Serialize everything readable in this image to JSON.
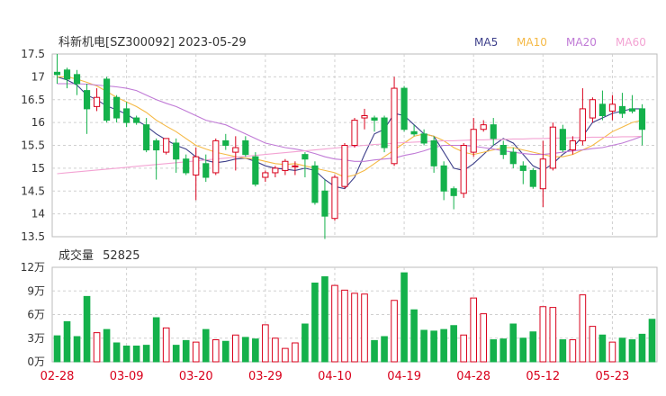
{
  "header": {
    "title": "科新机电[SZ300092] 2023-05-29"
  },
  "volume_header": {
    "label": "成交量",
    "value": "52825"
  },
  "legend": [
    {
      "name": "MA5",
      "color": "#3d3f8a"
    },
    {
      "name": "MA10",
      "color": "#f5b945"
    },
    {
      "name": "MA20",
      "color": "#c07ad6"
    },
    {
      "name": "MA60",
      "color": "#f3a3d3"
    }
  ],
  "colors": {
    "up": "#d9001b",
    "down": "#14b14b"
  },
  "chart_data": [
    {
      "type": "candlestick",
      "title": "科新机电[SZ300092] 2023-05-29",
      "ylim": [
        13.5,
        17.5
      ],
      "y_ticks": [
        "17.5",
        "17",
        "16.5",
        "16",
        "15.5",
        "15",
        "14.5",
        "14",
        "13.5"
      ],
      "x_tick_labels": [
        "02-28",
        "03-09",
        "03-20",
        "03-29",
        "04-10",
        "04-19",
        "04-28",
        "05-12",
        "05-23"
      ],
      "x_tick_index": [
        0,
        7,
        14,
        21,
        28,
        35,
        42,
        49,
        56
      ],
      "candles": [
        [
          17.1,
          17.05,
          17.5,
          16.85
        ],
        [
          17.15,
          16.95,
          17.2,
          16.75
        ],
        [
          17.05,
          16.85,
          17.15,
          16.6
        ],
        [
          16.7,
          16.3,
          16.85,
          15.75
        ],
        [
          16.35,
          16.55,
          16.75,
          16.25
        ],
        [
          16.95,
          16.05,
          17.0,
          16.0
        ],
        [
          16.55,
          16.1,
          16.6,
          16.0
        ],
        [
          16.3,
          16.0,
          16.45,
          15.9
        ],
        [
          16.1,
          16.0,
          16.15,
          15.95
        ],
        [
          15.95,
          15.4,
          16.1,
          15.35
        ],
        [
          15.6,
          15.4,
          15.65,
          14.75
        ],
        [
          15.35,
          15.65,
          15.65,
          15.3
        ],
        [
          15.55,
          15.2,
          15.65,
          14.9
        ],
        [
          15.2,
          14.9,
          15.3,
          14.85
        ],
        [
          14.85,
          15.25,
          15.45,
          14.3
        ],
        [
          15.1,
          14.8,
          15.3,
          14.7
        ],
        [
          14.9,
          15.6,
          15.65,
          14.85
        ],
        [
          15.6,
          15.5,
          15.75,
          15.4
        ],
        [
          15.35,
          15.45,
          15.7,
          14.95
        ],
        [
          15.6,
          15.3,
          15.7,
          15.25
        ],
        [
          15.25,
          14.65,
          15.35,
          14.6
        ],
        [
          14.8,
          14.9,
          14.95,
          14.7
        ],
        [
          14.9,
          15.0,
          15.05,
          14.8
        ],
        [
          14.95,
          15.15,
          15.2,
          14.85
        ],
        [
          15.05,
          15.05,
          15.15,
          14.85
        ],
        [
          15.3,
          15.2,
          15.35,
          14.8
        ],
        [
          15.05,
          14.25,
          15.15,
          14.2
        ],
        [
          14.5,
          13.95,
          14.75,
          13.45
        ],
        [
          13.9,
          14.8,
          14.85,
          13.85
        ],
        [
          14.6,
          15.5,
          15.55,
          14.55
        ],
        [
          15.5,
          16.05,
          16.1,
          15.45
        ],
        [
          16.1,
          16.15,
          16.3,
          15.85
        ],
        [
          16.1,
          16.05,
          16.15,
          15.8
        ],
        [
          16.1,
          15.45,
          16.15,
          15.35
        ],
        [
          15.1,
          16.75,
          17.0,
          15.05
        ],
        [
          16.75,
          15.85,
          16.8,
          15.8
        ],
        [
          15.8,
          15.75,
          15.95,
          15.7
        ],
        [
          15.75,
          15.55,
          15.85,
          15.5
        ],
        [
          15.6,
          15.05,
          15.7,
          14.9
        ],
        [
          15.05,
          14.5,
          15.15,
          14.3
        ],
        [
          14.55,
          14.4,
          14.6,
          14.1
        ],
        [
          14.45,
          15.5,
          15.55,
          14.35
        ],
        [
          15.35,
          15.85,
          16.1,
          15.25
        ],
        [
          15.85,
          15.95,
          16.05,
          15.8
        ],
        [
          15.95,
          15.65,
          16.1,
          15.5
        ],
        [
          15.5,
          15.3,
          15.6,
          15.2
        ],
        [
          15.35,
          15.1,
          15.45,
          15.0
        ],
        [
          15.05,
          14.95,
          15.15,
          14.65
        ],
        [
          14.95,
          14.6,
          15.0,
          14.55
        ],
        [
          14.55,
          15.2,
          15.6,
          14.15
        ],
        [
          15.0,
          15.9,
          16.0,
          14.95
        ],
        [
          15.85,
          15.4,
          15.95,
          15.35
        ],
        [
          15.4,
          15.6,
          15.7,
          15.3
        ],
        [
          15.6,
          16.3,
          16.75,
          15.5
        ],
        [
          16.1,
          16.5,
          16.55,
          16.0
        ],
        [
          16.4,
          16.15,
          16.7,
          16.05
        ],
        [
          16.25,
          16.4,
          16.6,
          16.05
        ],
        [
          16.35,
          16.2,
          16.65,
          16.1
        ],
        [
          16.3,
          16.25,
          16.6,
          16.2
        ],
        [
          16.3,
          15.85,
          16.4,
          15.5
        ]
      ],
      "ma": {
        "MA5": [
          17.0,
          16.93,
          16.82,
          16.6,
          16.5,
          16.36,
          16.28,
          16.18,
          16.05,
          15.92,
          15.75,
          15.62,
          15.5,
          15.42,
          15.25,
          15.17,
          15.12,
          15.15,
          15.2,
          15.22,
          15.15,
          15.05,
          15.0,
          14.98,
          14.95,
          15.0,
          14.95,
          14.75,
          14.6,
          14.55,
          14.8,
          15.3,
          15.75,
          15.85,
          16.2,
          16.15,
          15.95,
          15.75,
          15.7,
          15.35,
          15.0,
          14.95,
          15.1,
          15.3,
          15.5,
          15.65,
          15.55,
          15.3,
          15.05,
          14.95,
          15.1,
          15.3,
          15.45,
          15.7,
          16.0,
          16.1,
          16.2,
          16.25,
          16.3,
          16.3
        ],
        "MA10": [
          17.0,
          17.0,
          16.95,
          16.88,
          16.8,
          16.68,
          16.55,
          16.45,
          16.35,
          16.22,
          16.05,
          15.92,
          15.8,
          15.65,
          15.5,
          15.42,
          15.35,
          15.3,
          15.25,
          15.22,
          15.2,
          15.15,
          15.1,
          15.08,
          15.1,
          15.05,
          15.0,
          14.95,
          14.9,
          14.8,
          14.85,
          14.95,
          15.1,
          15.25,
          15.4,
          15.55,
          15.7,
          15.75,
          15.7,
          15.6,
          15.45,
          15.35,
          15.3,
          15.35,
          15.4,
          15.45,
          15.45,
          15.4,
          15.35,
          15.3,
          15.25,
          15.25,
          15.3,
          15.4,
          15.5,
          15.65,
          15.8,
          15.9,
          16.0,
          16.05
        ],
        "MA20": [
          16.85,
          16.85,
          16.85,
          16.84,
          16.82,
          16.8,
          16.78,
          16.75,
          16.7,
          16.6,
          16.5,
          16.42,
          16.35,
          16.25,
          16.15,
          16.05,
          16.0,
          15.95,
          15.85,
          15.75,
          15.65,
          15.55,
          15.5,
          15.45,
          15.42,
          15.38,
          15.32,
          15.25,
          15.2,
          15.18,
          15.15,
          15.15,
          15.18,
          15.2,
          15.22,
          15.28,
          15.32,
          15.38,
          15.45,
          15.5,
          15.5,
          15.5,
          15.48,
          15.45,
          15.42,
          15.38,
          15.35,
          15.32,
          15.3,
          15.3,
          15.32,
          15.35,
          15.38,
          15.4,
          15.43,
          15.45,
          15.5,
          15.55,
          15.62,
          15.7
        ],
        "MA60": [
          14.88,
          14.9,
          14.92,
          14.94,
          14.96,
          14.98,
          15.0,
          15.02,
          15.04,
          15.06,
          15.08,
          15.1,
          15.12,
          15.14,
          15.16,
          15.18,
          15.2,
          15.22,
          15.24,
          15.26,
          15.28,
          15.3,
          15.32,
          15.34,
          15.36,
          15.38,
          15.4,
          15.42,
          15.44,
          15.46,
          15.48,
          15.5,
          15.52,
          15.53,
          15.55,
          15.56,
          15.57,
          15.58,
          15.59,
          15.6,
          15.6,
          15.61,
          15.62,
          15.62,
          15.63,
          15.63,
          15.64,
          15.64,
          15.65,
          15.65,
          15.66,
          15.66,
          15.67,
          15.67,
          15.68,
          15.68,
          15.68,
          15.69,
          15.69,
          15.7
        ]
      }
    },
    {
      "type": "bar",
      "title": "成交量 52825",
      "ylim": [
        0,
        12
      ],
      "y_ticks": [
        "12万",
        "9万",
        "6万",
        "3万",
        "0万"
      ],
      "unit": "万",
      "values": [
        3.3,
        5.1,
        3.2,
        8.3,
        3.7,
        4.1,
        2.4,
        2.0,
        2.0,
        2.1,
        5.6,
        4.3,
        2.1,
        2.7,
        2.5,
        4.1,
        2.8,
        2.6,
        3.4,
        3.1,
        2.9,
        4.7,
        3.0,
        1.7,
        2.4,
        4.8,
        10.0,
        10.8,
        9.7,
        9.1,
        8.7,
        8.6,
        2.7,
        3.2,
        7.8,
        11.3,
        6.6,
        4.0,
        3.9,
        4.1,
        4.6,
        3.4,
        8.1,
        6.1,
        2.8,
        2.9,
        4.8,
        3.0,
        3.8,
        7.0,
        6.9,
        2.8,
        2.8,
        8.5,
        4.5,
        3.4,
        2.5,
        3.0,
        2.8,
        3.5,
        5.4
      ]
    }
  ]
}
